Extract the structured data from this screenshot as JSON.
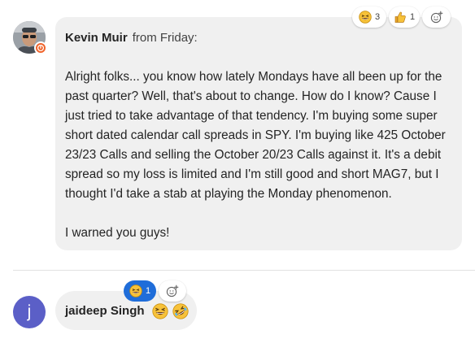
{
  "message1": {
    "author": "Kevin Muir",
    "timestamp": "from Friday:",
    "body": "Alright folks... you know how lately Mondays have all been up for the past quarter? Well, that's about to change. How do I know? Cause I just tried to take advantage of that tendency. I'm buying some super short dated calendar call spreads in SPY. I'm buying like 425 October 23/23 Calls and selling the October 20/23 Calls against it. It's a debit spread so my loss is limited and I'm still good and short MAG7, but I thought I'd take a stab at playing the Monday phenomenon.\n\nI warned you guys!",
    "reactions": [
      {
        "icon": "laugh-emoji-icon",
        "count": "3"
      },
      {
        "icon": "thumbs-up-emoji-icon",
        "count": "1"
      }
    ]
  },
  "message2": {
    "avatar_initial": "j",
    "author": "jaideep Singh",
    "reactions": [
      {
        "icon": "laugh-emoji-icon",
        "count": "1"
      }
    ]
  },
  "colors": {
    "bubble": "#f0f0f0",
    "accent": "#1f6dd9",
    "avatar_purple": "#5b5fc7",
    "status_orange": "#f0632a"
  }
}
